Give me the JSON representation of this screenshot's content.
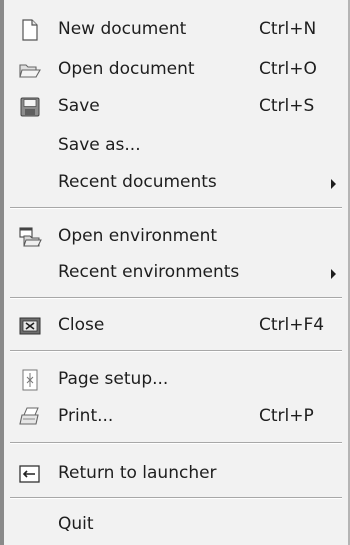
{
  "menu": {
    "items": [
      {
        "label": "New document",
        "shortcut": "Ctrl+N",
        "icon": "new-document-icon"
      },
      {
        "label": "Open document",
        "shortcut": "Ctrl+O",
        "icon": "open-folder-icon"
      },
      {
        "label": "Save",
        "shortcut": "Ctrl+S",
        "icon": "save-floppy-icon"
      },
      {
        "label": "Save as...",
        "shortcut": ""
      },
      {
        "label": "Recent documents",
        "shortcut": "",
        "submenu": true
      },
      {
        "label": "Open environment",
        "shortcut": "",
        "icon": "open-environment-icon"
      },
      {
        "label": "Recent environments",
        "shortcut": "",
        "submenu": true
      },
      {
        "label": "Close",
        "shortcut": "Ctrl+F4",
        "icon": "close-window-icon"
      },
      {
        "label": "Page setup...",
        "shortcut": "",
        "icon": "page-setup-icon"
      },
      {
        "label": "Print...",
        "shortcut": "Ctrl+P",
        "icon": "printer-icon"
      },
      {
        "label": "Return to launcher",
        "shortcut": "",
        "icon": "return-arrow-icon"
      },
      {
        "label": "Quit",
        "shortcut": ""
      }
    ]
  }
}
